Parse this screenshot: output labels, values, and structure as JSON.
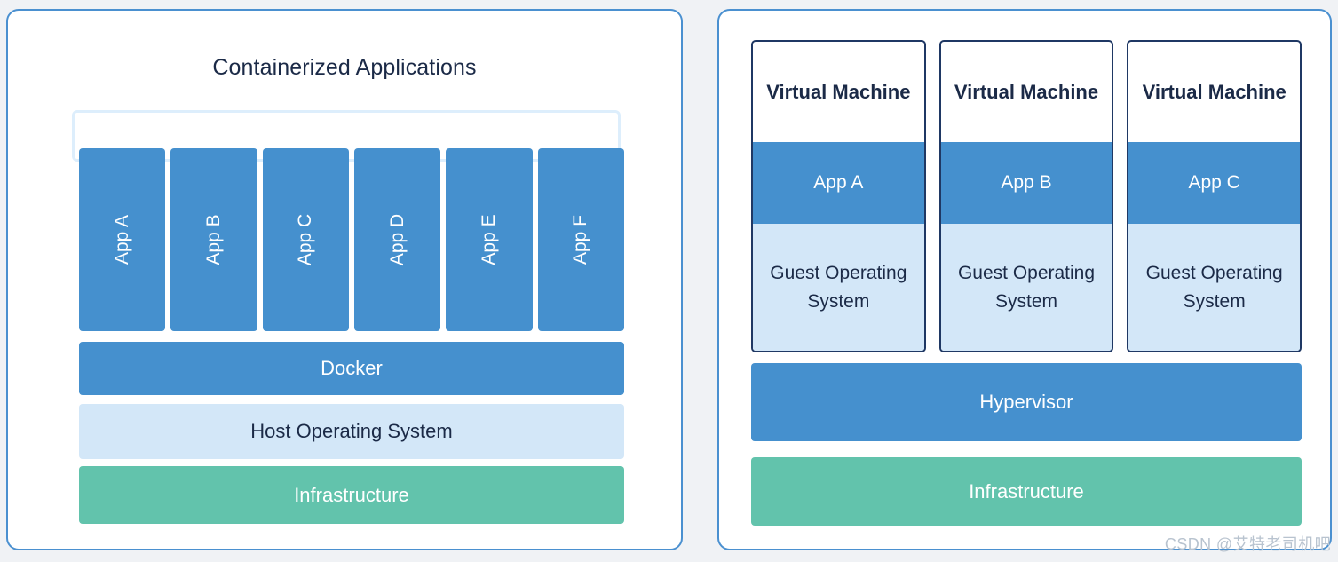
{
  "diagram": {
    "watermark": "CSDN @艾特老司机吧",
    "colors": {
      "background": "#f0f2f5",
      "panel_border": "#4a90d0",
      "accent_blue": "#4590ce",
      "light_blue": "#d3e7f8",
      "container_outline": "#ddeefc",
      "green": "#62c3ac",
      "navy_text": "#1b2a47",
      "vm_border": "#1f3864"
    },
    "left_panel": {
      "title": "Containerized Applications",
      "apps": [
        {
          "label": "App A"
        },
        {
          "label": "App B"
        },
        {
          "label": "App C"
        },
        {
          "label": "App D"
        },
        {
          "label": "App E"
        },
        {
          "label": "App F"
        }
      ],
      "layers": [
        {
          "label": "Docker",
          "color": "#4590ce"
        },
        {
          "label": "Host Operating System",
          "color": "#d3e7f8"
        },
        {
          "label": "Infrastructure",
          "color": "#62c3ac"
        }
      ]
    },
    "right_panel": {
      "vms": [
        {
          "title": "Virtual Machine",
          "app": "App A",
          "guest_os": "Guest Operating System"
        },
        {
          "title": "Virtual Machine",
          "app": "App B",
          "guest_os": "Guest Operating System"
        },
        {
          "title": "Virtual Machine",
          "app": "App C",
          "guest_os": "Guest Operating System"
        }
      ],
      "layers": [
        {
          "label": "Hypervisor",
          "color": "#4590ce"
        },
        {
          "label": "Infrastructure",
          "color": "#62c3ac"
        }
      ]
    }
  }
}
